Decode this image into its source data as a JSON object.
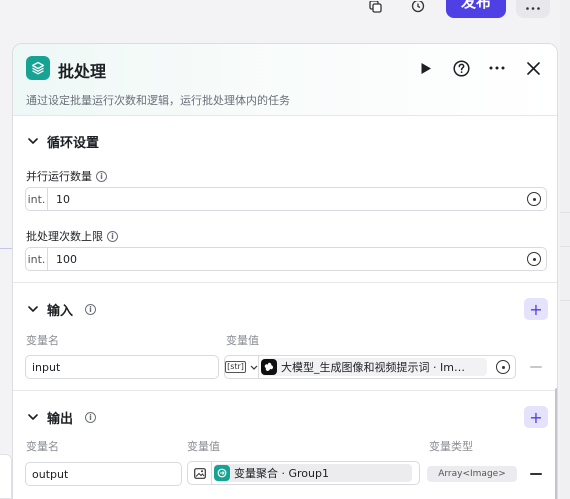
{
  "topbar": {
    "publish_label": "发布",
    "icons": [
      "copy-icon",
      "history-icon",
      "more-icon"
    ]
  },
  "panel": {
    "title": "批处理",
    "description": "通过设定批量运行次数和逻辑，运行批处理体内的任务",
    "actions": [
      "run-icon",
      "help-icon",
      "more-icon",
      "close-icon"
    ],
    "accent_color": "#16a394"
  },
  "loop": {
    "section_title": "循环设置",
    "parallel_label": "并行运行数量",
    "parallel_prefix": "int.",
    "parallel_value": "10",
    "limit_label": "批处理次数上限",
    "limit_prefix": "int.",
    "limit_value": "100"
  },
  "input": {
    "section_title": "输入",
    "col_name": "变量名",
    "col_value": "变量值",
    "rows": [
      {
        "name": "input",
        "type_tag": "[str]",
        "ref_text": "大模型_生成图像和视频提示词 · Im…"
      }
    ]
  },
  "output": {
    "section_title": "输出",
    "col_name": "变量名",
    "col_value": "变量值",
    "col_type": "变量类型",
    "rows": [
      {
        "name": "output",
        "ref_text": "变量聚合 · Group1",
        "type": "Array<Image>"
      }
    ]
  },
  "colors": {
    "primary": "#4e40e5",
    "add_bg": "#e4e3fb",
    "teal": "#16a394"
  }
}
